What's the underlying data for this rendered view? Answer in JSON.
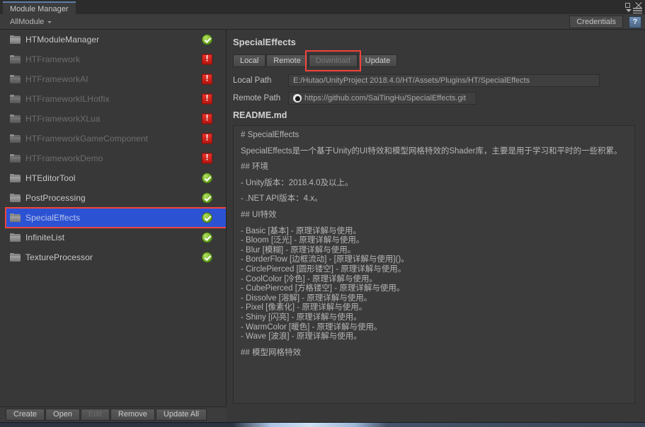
{
  "window": {
    "tab_title": "Module Manager",
    "minimize_icon": "restore-icon",
    "close_icon": "close-icon",
    "menu_icon": "hamburger-menu-icon"
  },
  "toolbar": {
    "filter_label": "AllModule",
    "filter_caret": "chevron-down-icon",
    "credentials_label": "Credentials",
    "help_label": "?"
  },
  "module_list": {
    "items": [
      {
        "name": "HTModuleManager",
        "status": "ok",
        "state": "installed",
        "selected": false
      },
      {
        "name": "HTFramework",
        "status": "warn",
        "state": "missing",
        "selected": false
      },
      {
        "name": "HTFrameworkAI",
        "status": "warn",
        "state": "missing",
        "selected": false
      },
      {
        "name": "HTFrameworkILHotfix",
        "status": "warn",
        "state": "missing",
        "selected": false
      },
      {
        "name": "HTFrameworkXLua",
        "status": "warn",
        "state": "missing",
        "selected": false
      },
      {
        "name": "HTFrameworkGameComponent",
        "status": "warn",
        "state": "missing",
        "selected": false
      },
      {
        "name": "HTFrameworkDemo",
        "status": "warn",
        "state": "missing",
        "selected": false
      },
      {
        "name": "HTEditorTool",
        "status": "ok",
        "state": "installed",
        "selected": false
      },
      {
        "name": "PostProcessing",
        "status": "ok",
        "state": "installed",
        "selected": false
      },
      {
        "name": "SpecialEffects",
        "status": "ok",
        "state": "installed",
        "selected": true
      },
      {
        "name": "InfiniteList",
        "status": "ok",
        "state": "installed",
        "selected": false
      },
      {
        "name": "TextureProcessor",
        "status": "ok",
        "state": "installed",
        "selected": false
      }
    ]
  },
  "bottom_bar": {
    "buttons": [
      {
        "label": "Create",
        "disabled": false
      },
      {
        "label": "Open",
        "disabled": false
      },
      {
        "label": "Edit",
        "disabled": true
      },
      {
        "label": "Remove",
        "disabled": false
      },
      {
        "label": "Update All",
        "disabled": false
      }
    ]
  },
  "detail": {
    "title": "SpecialEffects",
    "tabs": [
      {
        "label": "Local",
        "disabled": false,
        "highlighted": false
      },
      {
        "label": "Remote",
        "disabled": false,
        "highlighted": false
      },
      {
        "label": "Download",
        "disabled": true,
        "highlighted": true
      },
      {
        "label": "Update",
        "disabled": false,
        "highlighted": false
      }
    ],
    "local_path_label": "Local Path",
    "local_path_value": "E:/Hutao/UnityProject 2018.4.0/HT/Assets/Plugins/HT/SpecialEffects",
    "remote_path_label": "Remote Path",
    "remote_path_value": "https://github.com/SaiTingHu/SpecialEffects.git",
    "remote_path_icon": "github-icon",
    "readme_title": "README.md",
    "readme_lines": [
      "# SpecialEffects",
      "",
      "SpecialEffects是一个基于Unity的UI特效和模型网格特效的Shader库，主要是用于学习和平时的一些积累。",
      "",
      "## 环境",
      "",
      "- Unity版本：2018.4.0及以上。",
      "",
      "- .NET API版本：4.x。",
      "",
      "## UI特效",
      "",
      "- Basic [基本] - 原理详解与使用。",
      "- Bloom [泛光] - 原理详解与使用。",
      "- Blur [模糊] - 原理详解与使用。",
      "- BorderFlow [边框流动] - [原理详解与使用]()。",
      "- CirclePierced [圆形镂空] - 原理详解与使用。",
      "- CoolColor [冷色] - 原理详解与使用。",
      "- CubePierced [方格镂空] - 原理详解与使用。",
      "- Dissolve [溶解] - 原理详解与使用。",
      "- Pixel [像素化] - 原理详解与使用。",
      "- Shiny [闪亮] - 原理详解与使用。",
      "- WarmColor [暖色] - 原理详解与使用。",
      "- Wave [波浪] - 原理详解与使用。",
      "",
      "## 模型网格特效"
    ]
  },
  "colors": {
    "selection_blue": "#2c52d4",
    "highlight_red": "#f2433c",
    "status_ok_green": "#6aa520",
    "status_warn_red": "#c8201a",
    "panel_bg": "#383838"
  }
}
